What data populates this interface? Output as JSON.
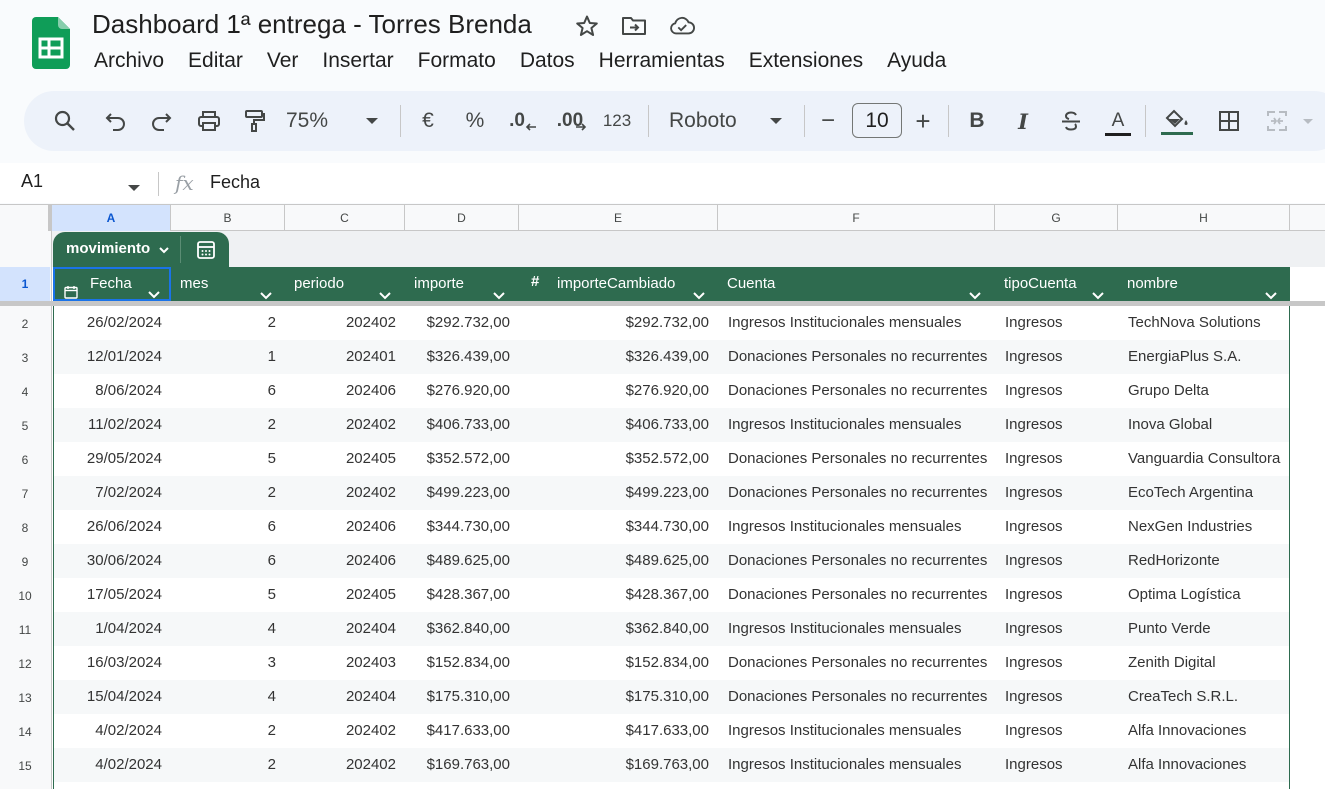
{
  "document": {
    "title": "Dashboard 1ª entrega - Torres Brenda",
    "icons": [
      "sheets-logo-icon",
      "star-icon",
      "move-folder-icon",
      "cloud-saved-icon"
    ]
  },
  "menu": [
    "Archivo",
    "Editar",
    "Ver",
    "Insertar",
    "Formato",
    "Datos",
    "Herramientas",
    "Extensiones",
    "Ayuda"
  ],
  "toolbar": {
    "zoom": "75%",
    "currency": "€",
    "percent": "%",
    "decrease_decimal": ".0",
    "increase_decimal": ".00",
    "number_format": "123",
    "font": "Roboto",
    "font_size": "10",
    "minus": "−",
    "plus": "+",
    "bold": "B",
    "italic": "I",
    "text_color": "A"
  },
  "formula_bar": {
    "cell_ref": "A1",
    "fx": "fx",
    "value": "Fecha"
  },
  "columns": [
    "A",
    "B",
    "C",
    "D",
    "E",
    "F",
    "G",
    "H"
  ],
  "row_numbers": [
    "1",
    "2",
    "3",
    "4",
    "5",
    "6",
    "7",
    "8",
    "9",
    "10",
    "11",
    "12",
    "13",
    "14",
    "15"
  ],
  "table": {
    "name": "movimiento",
    "number_type_symbol": "#",
    "headers": [
      "Fecha",
      "mes",
      "periodo",
      "importe",
      "importeCambiado",
      "Cuenta",
      "tipoCuenta",
      "nombre"
    ],
    "rows": [
      [
        "26/02/2024",
        "2",
        "202402",
        "$292.732,00",
        "$292.732,00",
        "Ingresos Institucionales mensuales",
        "Ingresos",
        "TechNova Solutions"
      ],
      [
        "12/01/2024",
        "1",
        "202401",
        "$326.439,00",
        "$326.439,00",
        "Donaciones Personales no recurrentes",
        "Ingresos",
        "EnergiaPlus S.A."
      ],
      [
        "8/06/2024",
        "6",
        "202406",
        "$276.920,00",
        "$276.920,00",
        "Donaciones Personales no recurrentes",
        "Ingresos",
        "Grupo Delta"
      ],
      [
        "11/02/2024",
        "2",
        "202402",
        "$406.733,00",
        "$406.733,00",
        "Ingresos Institucionales mensuales",
        "Ingresos",
        "Inova Global"
      ],
      [
        "29/05/2024",
        "5",
        "202405",
        "$352.572,00",
        "$352.572,00",
        "Donaciones Personales no recurrentes",
        "Ingresos",
        "Vanguardia Consultora"
      ],
      [
        "7/02/2024",
        "2",
        "202402",
        "$499.223,00",
        "$499.223,00",
        "Donaciones Personales no recurrentes",
        "Ingresos",
        "EcoTech Argentina"
      ],
      [
        "26/06/2024",
        "6",
        "202406",
        "$344.730,00",
        "$344.730,00",
        "Ingresos Institucionales mensuales",
        "Ingresos",
        "NexGen Industries"
      ],
      [
        "30/06/2024",
        "6",
        "202406",
        "$489.625,00",
        "$489.625,00",
        "Donaciones Personales no recurrentes",
        "Ingresos",
        "RedHorizonte"
      ],
      [
        "17/05/2024",
        "5",
        "202405",
        "$428.367,00",
        "$428.367,00",
        "Donaciones Personales no recurrentes",
        "Ingresos",
        "Optima Logística"
      ],
      [
        "1/04/2024",
        "4",
        "202404",
        "$362.840,00",
        "$362.840,00",
        "Ingresos Institucionales mensuales",
        "Ingresos",
        "Punto Verde"
      ],
      [
        "16/03/2024",
        "3",
        "202403",
        "$152.834,00",
        "$152.834,00",
        "Donaciones Personales no recurrentes",
        "Ingresos",
        "Zenith Digital"
      ],
      [
        "15/04/2024",
        "4",
        "202404",
        "$175.310,00",
        "$175.310,00",
        "Donaciones Personales no recurrentes",
        "Ingresos",
        "CreaTech S.R.L."
      ],
      [
        "4/02/2024",
        "2",
        "202402",
        "$417.633,00",
        "$417.633,00",
        "Ingresos Institucionales mensuales",
        "Ingresos",
        "Alfa Innovaciones"
      ],
      [
        "4/02/2024",
        "2",
        "202402",
        "$169.763,00",
        "$169.763,00",
        "Ingresos Institucionales mensuales",
        "Ingresos",
        "Alfa Innovaciones"
      ]
    ]
  },
  "colors": {
    "table_header": "#2e6b4f",
    "selection": "#1a73e8",
    "sheets_green": "#0f9d58"
  }
}
